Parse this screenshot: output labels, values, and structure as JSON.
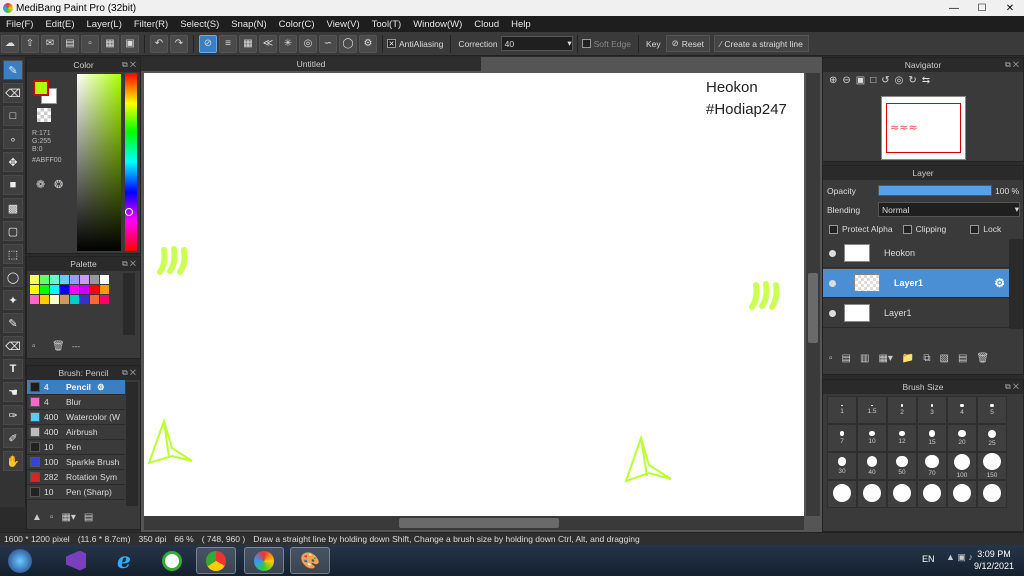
{
  "window": {
    "title": "MediBang Paint Pro (32bit)"
  },
  "menu": [
    "File(F)",
    "Edit(E)",
    "Layer(L)",
    "Filter(R)",
    "Select(S)",
    "Snap(N)",
    "Color(C)",
    "View(V)",
    "Tool(T)",
    "Window(W)",
    "Cloud",
    "Help"
  ],
  "toolbar": {
    "antialiasing": "AntiAliasing",
    "correction_label": "Correction",
    "correction_value": "40",
    "soft_edge": "Soft Edge",
    "key": "Key",
    "reset": "Reset",
    "straight_line": "Create a straight line"
  },
  "color_panel": {
    "title": "Color",
    "r": "R:171",
    "g": "G:255",
    "b": "B:0",
    "hex": "#ABFF00",
    "fg": "#ABFF00",
    "bg": "#FFFFFF"
  },
  "palette_panel": {
    "title": "Palette",
    "more": "---",
    "colors": [
      "#ffff66",
      "#66ff66",
      "#66ffcc",
      "#66ccff",
      "#9999ff",
      "#cc99ff",
      "#999999",
      "#ffffff",
      "#ffff00",
      "#00ff00",
      "#00ffff",
      "#0000ff",
      "#ff00ff",
      "#cc00ff",
      "#ff0000",
      "#ff9900",
      "#ff66cc",
      "#ffcc00",
      "#ffffcc",
      "#cc9966",
      "#00cccc",
      "#3333cc",
      "#ff6633",
      "#ff0066"
    ]
  },
  "brush_panel": {
    "title": "Brush: Pencil",
    "brushes": [
      {
        "size": "4",
        "name": "Pencil",
        "color": "#1e1e1e"
      },
      {
        "size": "4",
        "name": "Blur",
        "color": "#ff66cc"
      },
      {
        "size": "400",
        "name": "Watercolor (W",
        "color": "#55ccff"
      },
      {
        "size": "400",
        "name": "Airbrush",
        "color": "#bbbbbb"
      },
      {
        "size": "10",
        "name": "Pen",
        "color": "#222222"
      },
      {
        "size": "100",
        "name": "Sparkle Brush",
        "color": "#3344dd"
      },
      {
        "size": "282",
        "name": "Rotation Sym",
        "color": "#dd2222"
      },
      {
        "size": "10",
        "name": "Pen (Sharp)",
        "color": "#222222"
      }
    ]
  },
  "canvas": {
    "tab": "Untitled",
    "watermark_line1": "Heokon",
    "watermark_line2": "#Hodiap247"
  },
  "navigator": {
    "title": "Navigator"
  },
  "layer_panel": {
    "title": "Layer",
    "opacity_label": "Opacity",
    "opacity_value": "100 %",
    "opacity": 1.0,
    "blending_label": "Blending",
    "blending_value": "Normal",
    "protect_alpha": "Protect Alpha",
    "clipping": "Clipping",
    "lock": "Lock",
    "layers": [
      {
        "name": "Heokon",
        "selected": false
      },
      {
        "name": "Layer1",
        "selected": true
      },
      {
        "name": "Layer1",
        "selected": false
      }
    ]
  },
  "brush_size_panel": {
    "title": "Brush Size",
    "sizes": [
      "1",
      "1.5",
      "2",
      "3",
      "4",
      "5",
      "7",
      "10",
      "12",
      "15",
      "20",
      "25",
      "30",
      "40",
      "50",
      "70",
      "100",
      "150",
      "",
      "",
      "",
      "",
      "",
      ""
    ]
  },
  "status": {
    "dims": "1600 * 1200 pixel",
    "cm": "(11.6 * 8.7cm)",
    "dpi": "350 dpi",
    "zoom": "66 %",
    "coords": "( 748, 960 )",
    "hint": "Draw a straight line by holding down Shift, Change a brush size by holding down Ctrl, Alt, and dragging"
  },
  "taskbar": {
    "lang": "EN",
    "time": "3:09 PM",
    "date": "9/12/2021"
  },
  "colors": {
    "accent": "#3a7fc4",
    "lettering_top": "#ccff66",
    "lettering_bottom": "#ff6b6b"
  }
}
